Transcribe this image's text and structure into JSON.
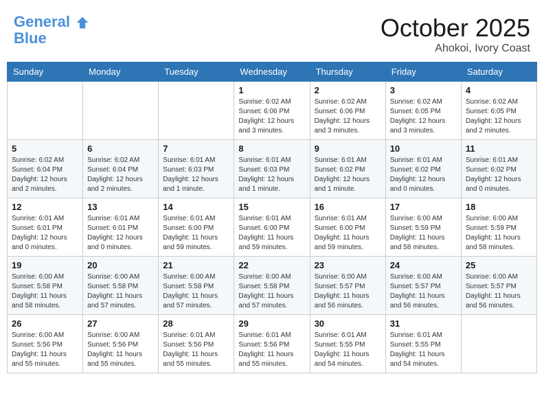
{
  "header": {
    "logo_line1": "General",
    "logo_line2": "Blue",
    "month": "October 2025",
    "location": "Ahokoi, Ivory Coast"
  },
  "weekdays": [
    "Sunday",
    "Monday",
    "Tuesday",
    "Wednesday",
    "Thursday",
    "Friday",
    "Saturday"
  ],
  "weeks": [
    [
      {
        "day": "",
        "info": ""
      },
      {
        "day": "",
        "info": ""
      },
      {
        "day": "",
        "info": ""
      },
      {
        "day": "1",
        "info": "Sunrise: 6:02 AM\nSunset: 6:06 PM\nDaylight: 12 hours\nand 3 minutes."
      },
      {
        "day": "2",
        "info": "Sunrise: 6:02 AM\nSunset: 6:06 PM\nDaylight: 12 hours\nand 3 minutes."
      },
      {
        "day": "3",
        "info": "Sunrise: 6:02 AM\nSunset: 6:05 PM\nDaylight: 12 hours\nand 3 minutes."
      },
      {
        "day": "4",
        "info": "Sunrise: 6:02 AM\nSunset: 6:05 PM\nDaylight: 12 hours\nand 2 minutes."
      }
    ],
    [
      {
        "day": "5",
        "info": "Sunrise: 6:02 AM\nSunset: 6:04 PM\nDaylight: 12 hours\nand 2 minutes."
      },
      {
        "day": "6",
        "info": "Sunrise: 6:02 AM\nSunset: 6:04 PM\nDaylight: 12 hours\nand 2 minutes."
      },
      {
        "day": "7",
        "info": "Sunrise: 6:01 AM\nSunset: 6:03 PM\nDaylight: 12 hours\nand 1 minute."
      },
      {
        "day": "8",
        "info": "Sunrise: 6:01 AM\nSunset: 6:03 PM\nDaylight: 12 hours\nand 1 minute."
      },
      {
        "day": "9",
        "info": "Sunrise: 6:01 AM\nSunset: 6:02 PM\nDaylight: 12 hours\nand 1 minute."
      },
      {
        "day": "10",
        "info": "Sunrise: 6:01 AM\nSunset: 6:02 PM\nDaylight: 12 hours\nand 0 minutes."
      },
      {
        "day": "11",
        "info": "Sunrise: 6:01 AM\nSunset: 6:02 PM\nDaylight: 12 hours\nand 0 minutes."
      }
    ],
    [
      {
        "day": "12",
        "info": "Sunrise: 6:01 AM\nSunset: 6:01 PM\nDaylight: 12 hours\nand 0 minutes."
      },
      {
        "day": "13",
        "info": "Sunrise: 6:01 AM\nSunset: 6:01 PM\nDaylight: 12 hours\nand 0 minutes."
      },
      {
        "day": "14",
        "info": "Sunrise: 6:01 AM\nSunset: 6:00 PM\nDaylight: 11 hours\nand 59 minutes."
      },
      {
        "day": "15",
        "info": "Sunrise: 6:01 AM\nSunset: 6:00 PM\nDaylight: 11 hours\nand 59 minutes."
      },
      {
        "day": "16",
        "info": "Sunrise: 6:01 AM\nSunset: 6:00 PM\nDaylight: 11 hours\nand 59 minutes."
      },
      {
        "day": "17",
        "info": "Sunrise: 6:00 AM\nSunset: 5:59 PM\nDaylight: 11 hours\nand 58 minutes."
      },
      {
        "day": "18",
        "info": "Sunrise: 6:00 AM\nSunset: 5:59 PM\nDaylight: 11 hours\nand 58 minutes."
      }
    ],
    [
      {
        "day": "19",
        "info": "Sunrise: 6:00 AM\nSunset: 5:58 PM\nDaylight: 11 hours\nand 58 minutes."
      },
      {
        "day": "20",
        "info": "Sunrise: 6:00 AM\nSunset: 5:58 PM\nDaylight: 11 hours\nand 57 minutes."
      },
      {
        "day": "21",
        "info": "Sunrise: 6:00 AM\nSunset: 5:58 PM\nDaylight: 11 hours\nand 57 minutes."
      },
      {
        "day": "22",
        "info": "Sunrise: 6:00 AM\nSunset: 5:58 PM\nDaylight: 11 hours\nand 57 minutes."
      },
      {
        "day": "23",
        "info": "Sunrise: 6:00 AM\nSunset: 5:57 PM\nDaylight: 11 hours\nand 56 minutes."
      },
      {
        "day": "24",
        "info": "Sunrise: 6:00 AM\nSunset: 5:57 PM\nDaylight: 11 hours\nand 56 minutes."
      },
      {
        "day": "25",
        "info": "Sunrise: 6:00 AM\nSunset: 5:57 PM\nDaylight: 11 hours\nand 56 minutes."
      }
    ],
    [
      {
        "day": "26",
        "info": "Sunrise: 6:00 AM\nSunset: 5:56 PM\nDaylight: 11 hours\nand 55 minutes."
      },
      {
        "day": "27",
        "info": "Sunrise: 6:00 AM\nSunset: 5:56 PM\nDaylight: 11 hours\nand 55 minutes."
      },
      {
        "day": "28",
        "info": "Sunrise: 6:01 AM\nSunset: 5:56 PM\nDaylight: 11 hours\nand 55 minutes."
      },
      {
        "day": "29",
        "info": "Sunrise: 6:01 AM\nSunset: 5:56 PM\nDaylight: 11 hours\nand 55 minutes."
      },
      {
        "day": "30",
        "info": "Sunrise: 6:01 AM\nSunset: 5:55 PM\nDaylight: 11 hours\nand 54 minutes."
      },
      {
        "day": "31",
        "info": "Sunrise: 6:01 AM\nSunset: 5:55 PM\nDaylight: 11 hours\nand 54 minutes."
      },
      {
        "day": "",
        "info": ""
      }
    ]
  ]
}
